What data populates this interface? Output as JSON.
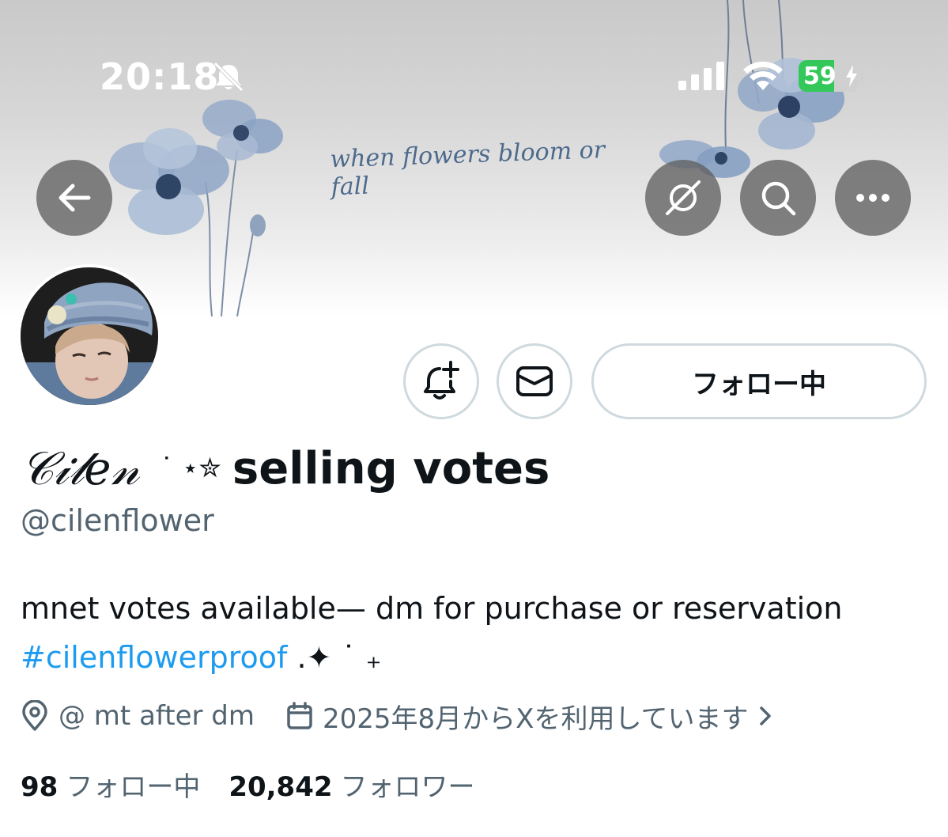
{
  "status_bar": {
    "time": "20:18",
    "battery": "59",
    "battery_level_percent": 59,
    "battery_color": "#34c759"
  },
  "banner": {
    "text": "when flowers bloom or fall"
  },
  "toolbar": {
    "back_icon": "arrow-left-icon",
    "grok_icon": "grok-icon",
    "search_icon": "search-icon",
    "more_icon": "more-dots-icon"
  },
  "actions": {
    "notify_icon": "bell-plus-icon",
    "message_icon": "envelope-icon",
    "follow_label": "フォロー中"
  },
  "profile": {
    "name_script": "𝒞𝒾𝓁𝑒𝓃",
    "name_deco": "˙ ⋆✮",
    "name_text": "selling votes",
    "handle": "@cilenflower",
    "bio_line1": "mnet votes available— dm for purchase or reservation",
    "bio_hashtag": "#cilenflowerproof",
    "bio_trailing": " .✦ ˙ ₊",
    "location": "@ mt after dm",
    "joined": "2025年8月からXを利用しています",
    "following_count": "98",
    "following_label": "フォロー中",
    "followers_count": "20,842",
    "followers_label": "フォロワー"
  },
  "colors": {
    "link": "#1d9bf0",
    "secondary_text": "#536471",
    "border": "#cfd9de"
  }
}
